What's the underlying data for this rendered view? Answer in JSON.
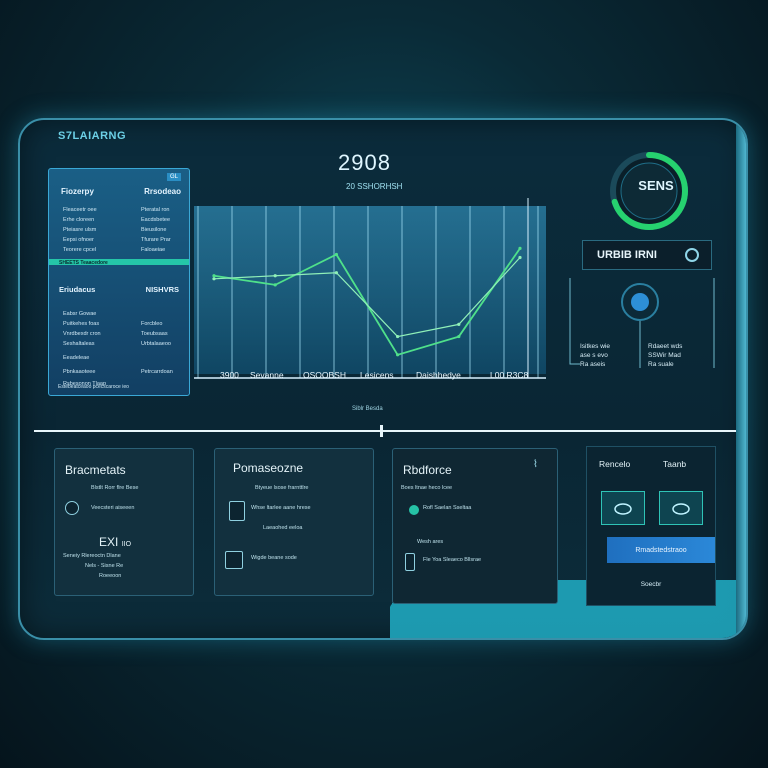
{
  "app": {
    "title": "S7LAIARNG"
  },
  "left_card": {
    "badge": "GL",
    "header_left": "Fiozerpy",
    "header_right": "Rrsodeao",
    "rows_top": [
      {
        "left": "Fleaceetr oee",
        "right": "Pteratal ron"
      },
      {
        "left": "Erhe cloreen",
        "right": "Eacdsbetee"
      },
      {
        "left": "Pteiasre ulsm",
        "right": "Bieusilone"
      },
      {
        "left": "Eepsi ofnoer",
        "right": "Tfurare Prar"
      },
      {
        "left": "Teorere cpcel",
        "right": "Faloaeiae"
      }
    ],
    "strip_label": "SHEETS  Teaacedore",
    "header2_left": "Eriudacus",
    "header2_right": "NISHVRS",
    "rows_bottom": [
      {
        "left": "Eabsr Gowae",
        "right": ""
      },
      {
        "left": "Puitkehes foas",
        "right": "Forcbleo"
      },
      {
        "left": "Vnrdbexdr cron",
        "right": "Toeubsaas"
      },
      {
        "left": "Seshaltaleas",
        "right": "Urbtalaaeoo"
      },
      {
        "left": "Eeadeleae",
        "right": ""
      },
      {
        "left": "Pbnkaaoteee",
        "right": "Petrcarrdoan"
      },
      {
        "left": "Rsbesonon Tlaap",
        "right": ""
      }
    ],
    "footer": "Estebeatceaoo pcecscaroce ieo"
  },
  "main_chart": {
    "title": "2908",
    "subtitle": "20 SSHORHSH",
    "x_labels": [
      "3900",
      "Sevanne",
      "OSOOBSH",
      "Lesicens",
      "Daishhedye",
      "L00 R3C8"
    ],
    "footer": "Siblr Besda"
  },
  "chart_data": {
    "type": "line",
    "title": "2908",
    "categories": [
      "3900",
      "Sevanne",
      "OSOOBSH",
      "Lesicens",
      "Daishhedye",
      "L00 R3C8"
    ],
    "series": [
      {
        "values": [
          62,
          56,
          76,
          10,
          22,
          80
        ]
      },
      {
        "values": [
          60,
          62,
          64,
          22,
          30,
          74
        ]
      }
    ],
    "ylim": [
      0,
      100
    ],
    "grid": true
  },
  "gauge": {
    "value_label": "SENS",
    "fraction": 0.7
  },
  "toggle": {
    "label": "URBIB IRNI"
  },
  "right_stats": [
    {
      "lines": [
        "Isitkes wie",
        "ase  s evo",
        "Ra  aseis"
      ]
    },
    {
      "lines": [
        "Rdaeet wds",
        "SSWir  Mad",
        "Ra  suale"
      ]
    }
  ],
  "bottom_cards": [
    {
      "title": "Bracmetats",
      "lines": [
        "Blstlt Rorr flre Bese",
        "Veecsteri aiseeen",
        "Seneiy Rlereoctn Dlane",
        "Nels  - Sisne Re",
        "Roeeoon"
      ],
      "big": "EXI",
      "big_suffix": "IIO"
    },
    {
      "title": "Pomaseozne",
      "lines": [
        "Btyeue  lsose frarnttlre",
        "Whse ltarlee  aane hrese",
        "Laeaohed eeloa",
        "Wigde beane  sode"
      ]
    },
    {
      "title": "Rbdforce",
      "lines": [
        "Boes ltnae  heco lcee",
        "Rofl Saelan Sseltaa",
        "Wesh ares",
        "Fle  Yoa Sleaeco Bllsrae"
      ]
    }
  ],
  "right_panel": {
    "label_left": "Rencelo",
    "label_right": "Taanb",
    "button": "Rmadstedstraoo",
    "footer": "Soecbr"
  }
}
